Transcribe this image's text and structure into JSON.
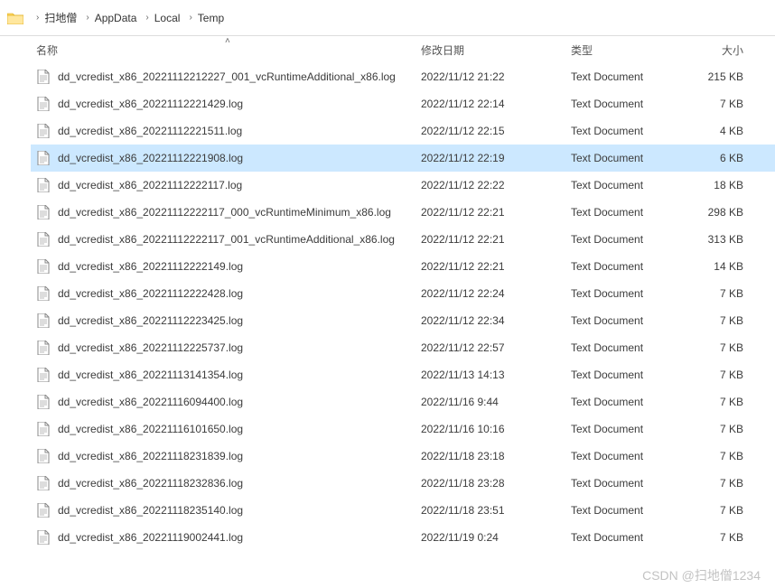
{
  "breadcrumbs": [
    "扫地僧",
    "AppData",
    "Local",
    "Temp"
  ],
  "columns": {
    "name": "名称",
    "date": "修改日期",
    "type": "类型",
    "size": "大小"
  },
  "sort_col": "name",
  "files": [
    {
      "name": "dd_vcredist_x86_20221112212227_001_vcRuntimeAdditional_x86.log",
      "date": "2022/11/12 21:22",
      "type": "Text Document",
      "size": "215 KB",
      "selected": false
    },
    {
      "name": "dd_vcredist_x86_20221112221429.log",
      "date": "2022/11/12 22:14",
      "type": "Text Document",
      "size": "7 KB",
      "selected": false
    },
    {
      "name": "dd_vcredist_x86_20221112221511.log",
      "date": "2022/11/12 22:15",
      "type": "Text Document",
      "size": "4 KB",
      "selected": false
    },
    {
      "name": "dd_vcredist_x86_20221112221908.log",
      "date": "2022/11/12 22:19",
      "type": "Text Document",
      "size": "6 KB",
      "selected": true
    },
    {
      "name": "dd_vcredist_x86_20221112222117.log",
      "date": "2022/11/12 22:22",
      "type": "Text Document",
      "size": "18 KB",
      "selected": false
    },
    {
      "name": "dd_vcredist_x86_20221112222117_000_vcRuntimeMinimum_x86.log",
      "date": "2022/11/12 22:21",
      "type": "Text Document",
      "size": "298 KB",
      "selected": false
    },
    {
      "name": "dd_vcredist_x86_20221112222117_001_vcRuntimeAdditional_x86.log",
      "date": "2022/11/12 22:21",
      "type": "Text Document",
      "size": "313 KB",
      "selected": false
    },
    {
      "name": "dd_vcredist_x86_20221112222149.log",
      "date": "2022/11/12 22:21",
      "type": "Text Document",
      "size": "14 KB",
      "selected": false
    },
    {
      "name": "dd_vcredist_x86_20221112222428.log",
      "date": "2022/11/12 22:24",
      "type": "Text Document",
      "size": "7 KB",
      "selected": false
    },
    {
      "name": "dd_vcredist_x86_20221112223425.log",
      "date": "2022/11/12 22:34",
      "type": "Text Document",
      "size": "7 KB",
      "selected": false
    },
    {
      "name": "dd_vcredist_x86_20221112225737.log",
      "date": "2022/11/12 22:57",
      "type": "Text Document",
      "size": "7 KB",
      "selected": false
    },
    {
      "name": "dd_vcredist_x86_20221113141354.log",
      "date": "2022/11/13 14:13",
      "type": "Text Document",
      "size": "7 KB",
      "selected": false
    },
    {
      "name": "dd_vcredist_x86_20221116094400.log",
      "date": "2022/11/16 9:44",
      "type": "Text Document",
      "size": "7 KB",
      "selected": false
    },
    {
      "name": "dd_vcredist_x86_20221116101650.log",
      "date": "2022/11/16 10:16",
      "type": "Text Document",
      "size": "7 KB",
      "selected": false
    },
    {
      "name": "dd_vcredist_x86_20221118231839.log",
      "date": "2022/11/18 23:18",
      "type": "Text Document",
      "size": "7 KB",
      "selected": false
    },
    {
      "name": "dd_vcredist_x86_20221118232836.log",
      "date": "2022/11/18 23:28",
      "type": "Text Document",
      "size": "7 KB",
      "selected": false
    },
    {
      "name": "dd_vcredist_x86_20221118235140.log",
      "date": "2022/11/18 23:51",
      "type": "Text Document",
      "size": "7 KB",
      "selected": false
    },
    {
      "name": "dd_vcredist_x86_20221119002441.log",
      "date": "2022/11/19 0:24",
      "type": "Text Document",
      "size": "7 KB",
      "selected": false
    }
  ],
  "watermark": "CSDN @扫地僧1234"
}
